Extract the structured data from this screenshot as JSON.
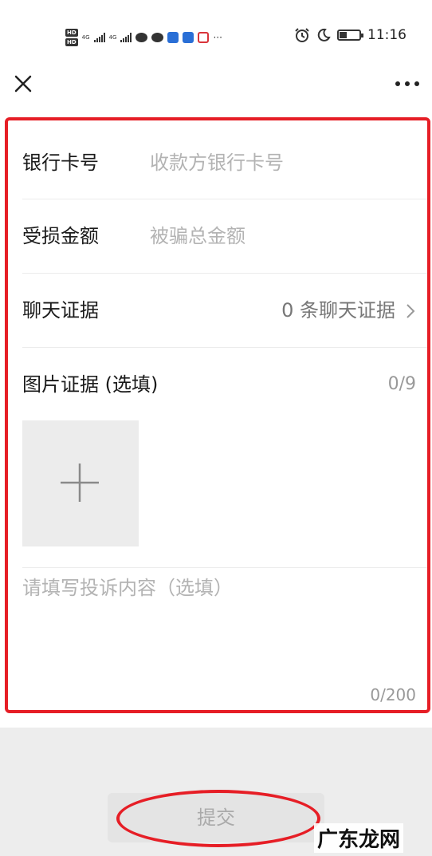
{
  "status_bar": {
    "hd": [
      "HD",
      "HD"
    ],
    "network": [
      "4G",
      "4G"
    ],
    "time": "11:16",
    "more": "···"
  },
  "nav": {
    "close_icon": "close-icon",
    "more_icon": "more-horizontal-icon"
  },
  "form": {
    "bank_card": {
      "label": "银行卡号",
      "placeholder": "收款方银行卡号"
    },
    "amount": {
      "label": "受损金额",
      "placeholder": "被骗总金额"
    },
    "chat_evidence": {
      "label": "聊天证据",
      "value": "0 条聊天证据"
    },
    "image_evidence": {
      "label": "图片证据 (选填)",
      "count": "0/9"
    },
    "complaint": {
      "placeholder": "请填写投诉内容（选填）",
      "count": "0/200"
    }
  },
  "submit": {
    "label": "提交"
  },
  "watermark": {
    "text": "广东龙网"
  },
  "colors": {
    "highlight": "#e61e26",
    "placeholder": "#b3b3b3",
    "background": "#ededed"
  }
}
